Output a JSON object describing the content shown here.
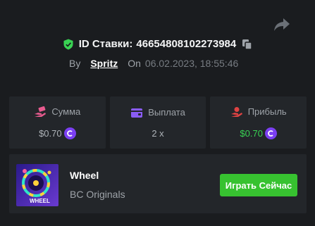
{
  "share": {
    "icon": "share-arrow-icon"
  },
  "bet": {
    "id_label": "ID Ставки:",
    "id_value": "46654808102273984",
    "by_label": "By",
    "user": "Spritz",
    "on_label": "On",
    "date": "06.02.2023, 18:55:46"
  },
  "stats": [
    {
      "label": "Сумма",
      "value": "$0.70",
      "icon": "money-hand-icon",
      "has_coin": true
    },
    {
      "label": "Выплата",
      "value": "2 x",
      "icon": "wallet-icon",
      "has_coin": false
    },
    {
      "label": "Прибыль",
      "value": "$0.70",
      "icon": "profit-hand-icon",
      "has_coin": true
    }
  ],
  "game": {
    "title": "Wheel",
    "subtitle": "BC Originals",
    "thumb_text": "WHEEL",
    "play_label": "Играть Сейчас"
  },
  "colors": {
    "background": "#1a1c1f",
    "card": "#23262a",
    "verified": "#39d353",
    "profit": "#39d353",
    "coin": "#7b3ff2",
    "play_button": "#37c230",
    "amount_icon": "#e85b8f",
    "payout_icon": "#8a5cf5",
    "profit_icon": "#e04343"
  }
}
